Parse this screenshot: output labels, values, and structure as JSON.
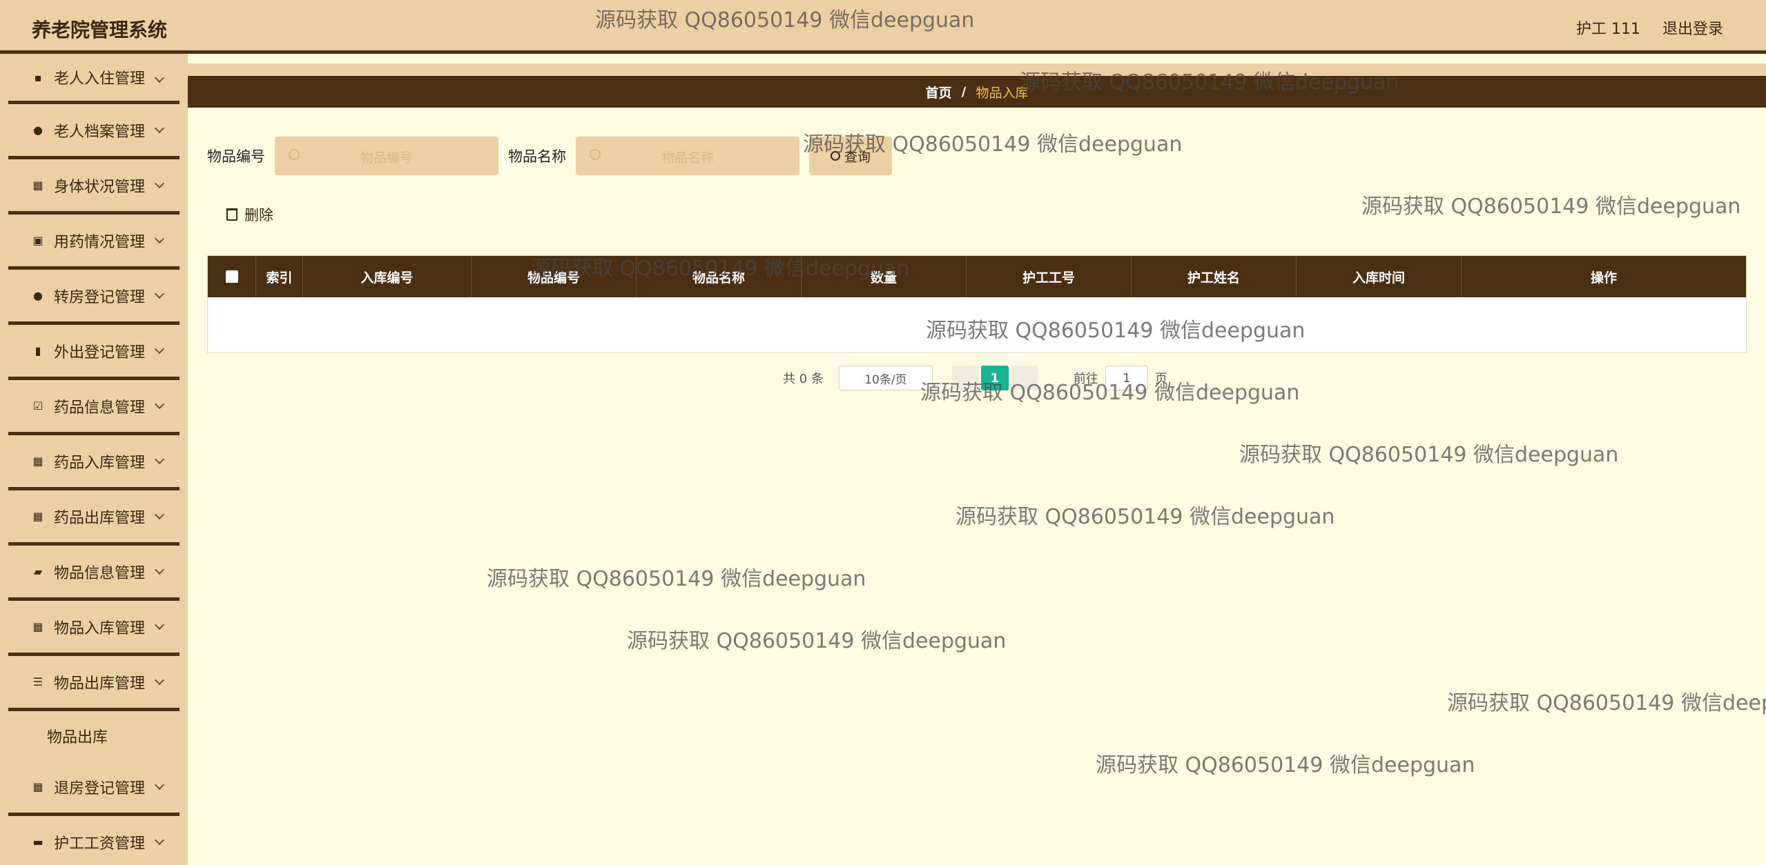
{
  "app": {
    "title": "养老院管理系统"
  },
  "header": {
    "user": "护工 111",
    "logout": "退出登录"
  },
  "sidebar": {
    "items": [
      {
        "label": "老人入住管理",
        "icon": "chat-icon"
      },
      {
        "label": "老人档案管理",
        "icon": "user-icon"
      },
      {
        "label": "身体状况管理",
        "icon": "grid-icon"
      },
      {
        "label": "用药情况管理",
        "icon": "clipboard-check-icon"
      },
      {
        "label": "转房登记管理",
        "icon": "location-pin-icon"
      },
      {
        "label": "外出登记管理",
        "icon": "bar-chart-icon"
      },
      {
        "label": "药品信息管理",
        "icon": "checkbox-icon"
      },
      {
        "label": "药品入库管理",
        "icon": "grid-icon"
      },
      {
        "label": "药品出库管理",
        "icon": "grid-icon"
      },
      {
        "label": "物品信息管理",
        "icon": "wallet-icon"
      },
      {
        "label": "物品入库管理",
        "icon": "grid-icon"
      },
      {
        "label": "物品出库管理",
        "icon": "list-icon"
      },
      {
        "label": "退房登记管理",
        "icon": "grid-icon"
      },
      {
        "label": "护工工资管理",
        "icon": "ticket-icon"
      }
    ],
    "subitem": "物品出库"
  },
  "breadcrumb": {
    "home": "首页",
    "separator": "/",
    "current": "物品入库"
  },
  "search": {
    "code_label": "物品编号",
    "code_placeholder": "物品编号",
    "name_label": "物品名称",
    "name_placeholder": "物品名称",
    "button": "查询"
  },
  "toolbar": {
    "delete": "删除"
  },
  "table": {
    "columns": [
      "索引",
      "入库编号",
      "物品编号",
      "物品名称",
      "数量",
      "护工工号",
      "护工姓名",
      "入库时间",
      "操作"
    ],
    "rows": []
  },
  "pagination": {
    "total": "共 0 条",
    "page_size": "10条/页",
    "current_page": "1",
    "goto_prefix": "前往",
    "goto_value": "1",
    "goto_suffix": "页"
  },
  "watermark": "源码获取 QQ86050149 微信deepguan",
  "colors": {
    "accent_dark": "#4a2f15",
    "panel_tan": "#ecd0a4",
    "page_bg": "#fdfbe2",
    "pager_active": "#1ab394",
    "breadcrumb_current": "#f2c14e"
  }
}
